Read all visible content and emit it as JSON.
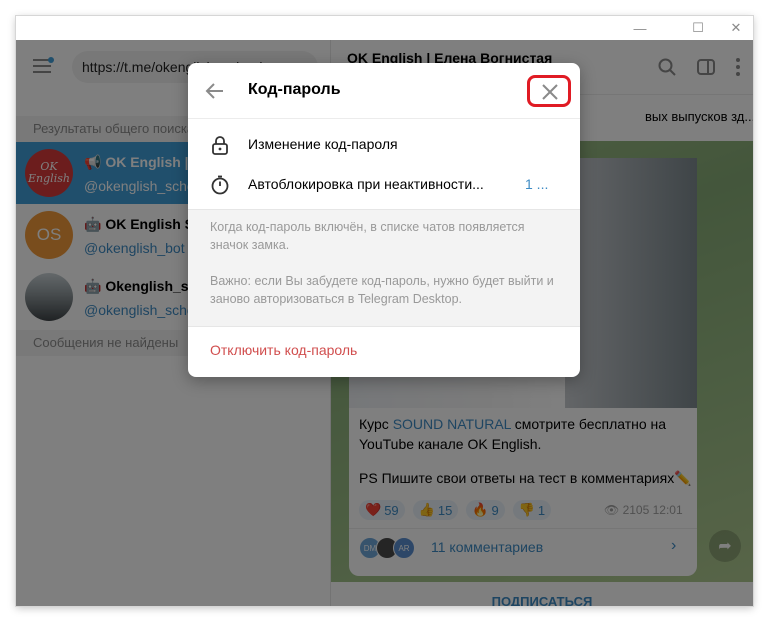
{
  "window": {
    "controls": [
      "—",
      "☐",
      "✕"
    ]
  },
  "sidebar": {
    "search_url": "https://t.me/okenglish_school",
    "results_header": "Результаты общего поиска",
    "chats": [
      {
        "name": "OK English | Елена Вогнистая",
        "handle": "@okenglish_school",
        "avatar_text": "OK English",
        "avatar_color": "#d93b3b",
        "kind": "channel"
      },
      {
        "name": "OK English School",
        "handle": "@okenglish_bot",
        "avatar_text": "OS",
        "avatar_color": "#f29b3a",
        "kind": "bot"
      },
      {
        "name": "Okenglish_school",
        "handle": "@okenglish_school",
        "avatar_text": "",
        "avatar_color": "#5c6064",
        "kind": "bot"
      }
    ],
    "no_messages": "Сообщения не найдены"
  },
  "channel": {
    "title": "OK English | Елена Вогнистая",
    "pinned_text": "вых выпусков зд...",
    "post": {
      "line1_prefix": "Курс ",
      "line1_link": "SOUND NATURAL",
      "line1_suffix": " смотрите бесплатно на",
      "line2": "YouTube канале OK English.",
      "line3": "PS Пишите свои ответы на тест в комментариях✏️",
      "reactions": [
        {
          "emoji": "❤️",
          "count": "59"
        },
        {
          "emoji": "👍",
          "count": "15"
        },
        {
          "emoji": "🔥",
          "count": "9"
        },
        {
          "emoji": "👎",
          "count": "1"
        }
      ],
      "views": "2105",
      "time": "12:01",
      "comment_avatars": [
        "DM",
        "",
        "AR"
      ],
      "comments_label": "11 комментариев"
    },
    "subscribe_label": "ПОДПИСАТЬСЯ"
  },
  "dialog": {
    "title": "Код-пароль",
    "rows": [
      {
        "label": "Изменение код-пароля",
        "value": ""
      },
      {
        "label": "Автоблокировка при неактивности...",
        "value": "1 ..."
      }
    ],
    "info_1": "Когда код-пароль включён, в списке чатов появляется значок замка.",
    "info_2": "Важно: если Вы забудете код-пароль, нужно будет выйти и заново авторизоваться в Telegram Desktop.",
    "disable_label": "Отключить код-пароль"
  },
  "colors": {
    "accent": "#3d8bc4",
    "active_chat": "#419fd9",
    "danger": "#d14e4e",
    "highlight": "#e01b24"
  }
}
